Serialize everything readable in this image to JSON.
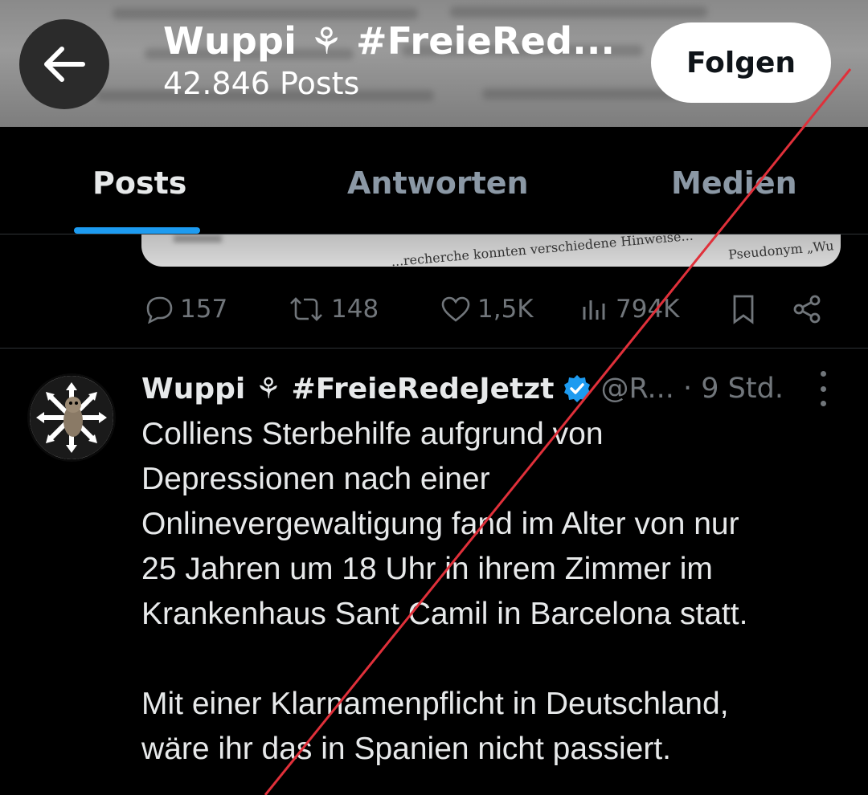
{
  "header": {
    "back_icon": "arrow-left-icon",
    "title": "Wuppi ⚘ #FreieRed...",
    "post_count": "42.846 Posts",
    "follow_label": "Folgen"
  },
  "tabs": [
    {
      "label": "Posts",
      "active": true
    },
    {
      "label": "Antworten",
      "active": false
    },
    {
      "label": "Medien",
      "active": false
    }
  ],
  "previous_post": {
    "media_text_1": "...recherche konnten verschiedene Hinweise...",
    "media_text_2": "Pseudonym „Wu",
    "actions": {
      "replies": "157",
      "reposts": "148",
      "likes": "1,5K",
      "views": "794K"
    }
  },
  "post": {
    "author": "Wuppi ⚘ #FreieRedeJetzt",
    "handle_time": "@R... · 9 Std.",
    "paragraph_1": "Colliens Sterbehilfe aufgrund von Depressionen nach einer Onlinevergewaltigung fand im Alter von nur 25 Jahren um 18 Uhr in ihrem Zimmer im Krankenhaus Sant Camil in Barcelona statt.",
    "line_1": "Colliens Sterbehilfe aufgrund von",
    "line_2": "Depressionen nach einer",
    "line_3": "Onlinevergewaltigung fand im Alter von nur",
    "line_4": "25 Jahren um 18 Uhr in ihrem Zimmer im",
    "line_5": "Krankenhaus Sant Camil in Barcelona statt.",
    "line_6": "Mit einer Klarnamenpflicht in Deutschland,",
    "line_7": "wäre ihr das in Spanien nicht passiert."
  },
  "colors": {
    "background": "#000000",
    "accent": "#1d9bf0",
    "muted": "#71767b",
    "strike": "#e0303a"
  }
}
